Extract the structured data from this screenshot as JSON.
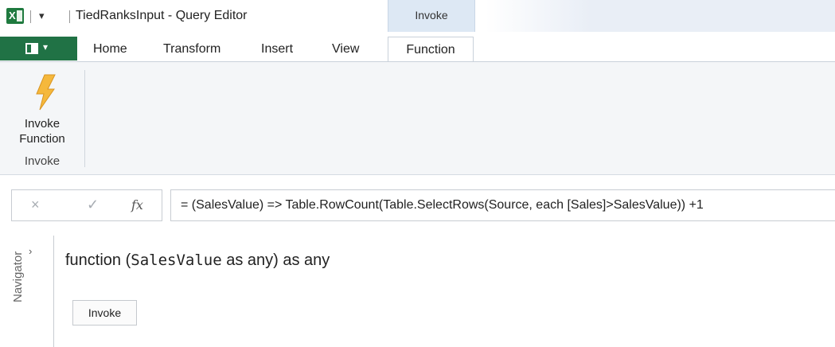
{
  "window": {
    "title": "TiedRanksInput - Query Editor",
    "contextual_tab_group": "Invoke",
    "app_icon": "excel-icon",
    "quick_access_icon": "customize-quick-access-icon"
  },
  "tabs": [
    {
      "label": "Home"
    },
    {
      "label": "Transform"
    },
    {
      "label": "Insert"
    },
    {
      "label": "View"
    },
    {
      "label": "Function",
      "active": true
    }
  ],
  "file_button": {
    "icon": "file-menu-icon"
  },
  "ribbon": {
    "button_line1": "Invoke",
    "button_line2": "Function",
    "button_icon": "lightning-bolt-icon",
    "group_label": "Invoke"
  },
  "formula_bar": {
    "cancel_glyph": "×",
    "confirm_glyph": "✓",
    "fx_glyph": "fx",
    "formula": "= (SalesValue) => Table.RowCount(Table.SelectRows(Source, each [Sales]>SalesValue)) +1"
  },
  "navigator": {
    "label": "Navigator",
    "chevron": "›"
  },
  "function_signature": {
    "prefix": "function (",
    "param": "SalesValue",
    "suffix": " as any) as any"
  },
  "invoke_button": {
    "label": "Invoke"
  },
  "colors": {
    "excel_green": "#207245",
    "contextual_tab_bg": "#dde8f4",
    "ribbon_bg": "#f4f6f8",
    "bolt_fill": "#f5b83c"
  }
}
